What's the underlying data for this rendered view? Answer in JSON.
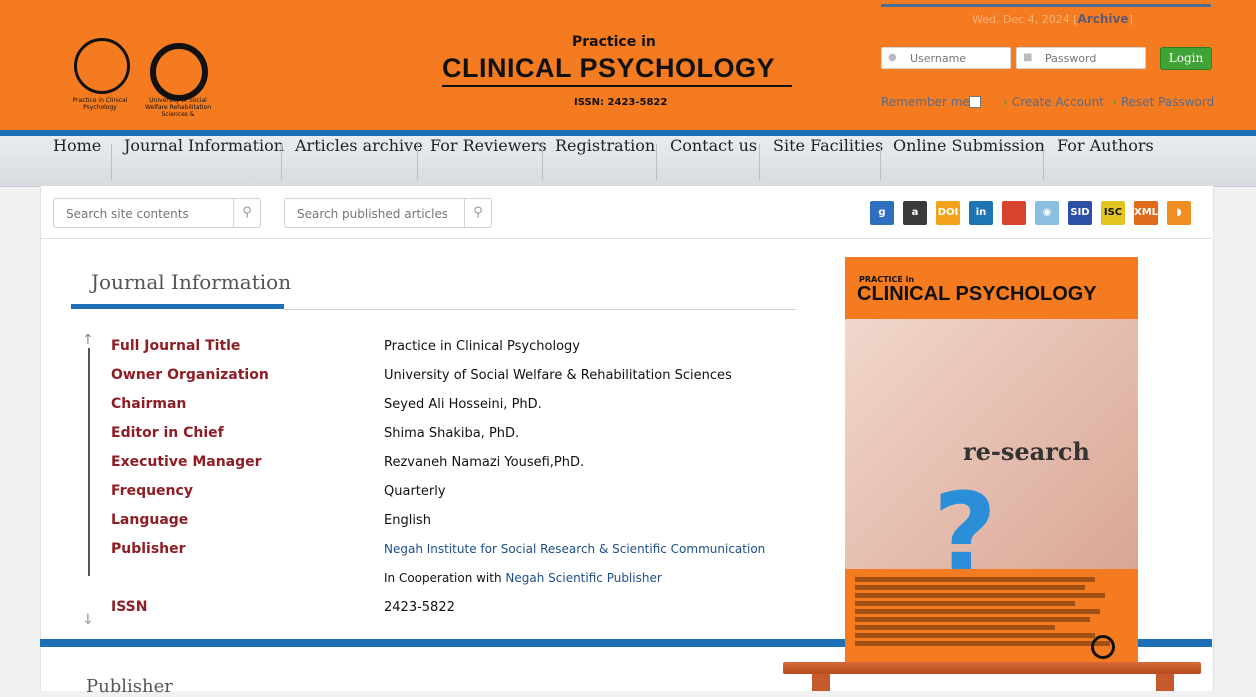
{
  "header": {
    "logo1_caption": "Practice in Clinical Psychology",
    "logo2_caption": "University of Social Welfare Rehabilitation Sciences &",
    "brand_top": "Practice in",
    "brand_main": "CLINICAL PSYCHOLOGY",
    "issn": "ISSN: 2423-5822",
    "date": "Wed, Dec 4, 2024",
    "archive": "Archive",
    "username_placeholder": "Username",
    "password_placeholder": "Password",
    "login": "Login",
    "remember": "Remember me",
    "create_account": "Create Account",
    "reset_password": "Reset Password"
  },
  "nav": [
    "Home",
    "Journal Information",
    "Articles archive",
    "For Reviewers",
    "Registration",
    "Contact us",
    "Site Facilities",
    "Online Submission",
    "For Authors"
  ],
  "search": {
    "site_placeholder": "Search site contents",
    "articles_placeholder": "Search published articles"
  },
  "icons": [
    {
      "name": "google-scholar-icon",
      "label": "g",
      "color": "#2f6fbf"
    },
    {
      "name": "academia-icon",
      "label": "a",
      "color": "#3a3a3a"
    },
    {
      "name": "doi-icon",
      "label": "DOI",
      "color": "#f3a21b"
    },
    {
      "name": "linkedin-icon",
      "label": "in",
      "color": "#1d75b4"
    },
    {
      "name": "library-icon",
      "label": "",
      "color": "#d8432f"
    },
    {
      "name": "eye-icon",
      "label": "◉",
      "color": "#8bbfe0"
    },
    {
      "name": "sid-icon",
      "label": "SID",
      "color": "#2b4ea6"
    },
    {
      "name": "isc-icon",
      "label": "ISC",
      "color": "#e3c521"
    },
    {
      "name": "xml-icon",
      "label": "XML",
      "color": "#e06a1c"
    },
    {
      "name": "rss-icon",
      "label": "◗",
      "color": "#f18e23"
    }
  ],
  "section_title": "Journal Information",
  "rows": [
    {
      "label": "Full Journal Title",
      "value": "Practice in Clinical Psychology"
    },
    {
      "label": "Owner Organization",
      "value": "University of Social Welfare & Rehabilitation Sciences"
    },
    {
      "label": "Chairman",
      "value": "Seyed Ali Hosseini, PhD."
    },
    {
      "label": "Editor in Chief",
      "value": "Shima Shakiba, PhD."
    },
    {
      "label": "Executive Manager",
      "value": "Rezvaneh Namazi Yousefi,PhD."
    },
    {
      "label": "Frequency",
      "value": "Quarterly"
    },
    {
      "label": "Language",
      "value": "English"
    },
    {
      "label": "Publisher",
      "value": "Negah Institute for Social Research & Scientific Communication"
    },
    {
      "label": "",
      "value_prefix": "In Cooperation with ",
      "value": "Negah Scientific Publisher"
    },
    {
      "label": "ISSN",
      "value": "2423-5822"
    }
  ],
  "publisher_heading": "Publisher",
  "cover": {
    "small": "PRACTICE in",
    "main": "CLINICAL PSYCHOLOGY",
    "word_research": "re-search"
  }
}
